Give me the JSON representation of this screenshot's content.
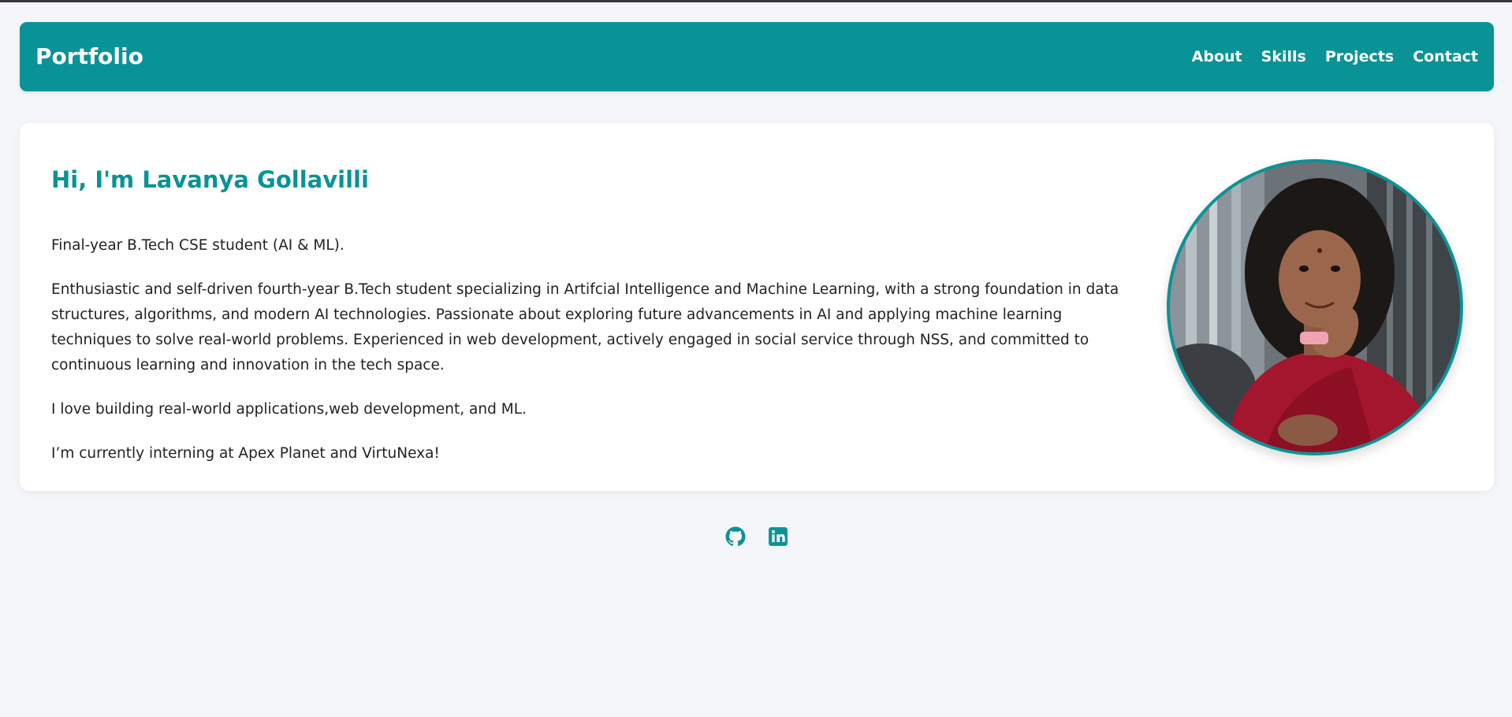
{
  "nav": {
    "brand": "Portfolio",
    "links": [
      "About",
      "Skills",
      "Projects",
      "Contact"
    ]
  },
  "hero": {
    "title": "Hi, I'm Lavanya Gollavilli",
    "paragraphs": [
      "Final-year B.Tech CSE student (AI & ML).",
      "Enthusiastic and self-driven fourth-year B.Tech student specializing in Artifcial Intelligence and Machine Learning, with a strong foundation in data structures, algorithms, and modern AI technologies. Passionate about exploring future advancements in AI and applying machine learning techniques to solve real-world problems. Experienced in web development, actively engaged in social service through NSS, and committed to continuous learning and innovation in the tech space.",
      "I love building real-world applications,web development, and ML.",
      "I’m currently interning at Apex Planet and VirtuNexa!"
    ],
    "photo_alt": "profile photo"
  },
  "footer": {
    "icons": [
      "github-icon",
      "linkedin-icon"
    ]
  },
  "colors": {
    "accent": "#0a9396",
    "background": "#f5f6f9",
    "card": "#ffffff",
    "text": "#222222"
  }
}
